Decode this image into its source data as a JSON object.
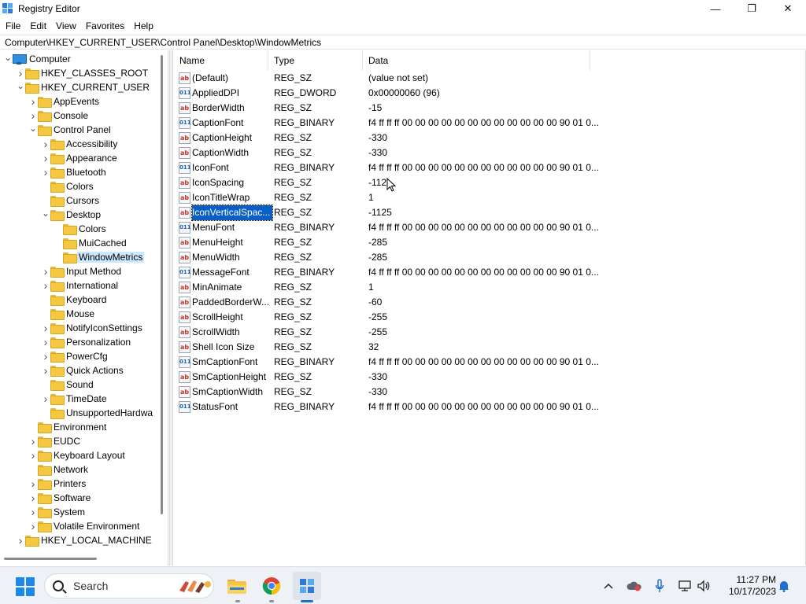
{
  "window": {
    "title": "Registry Editor",
    "controls": {
      "minimize": "—",
      "maximize": "❐",
      "close": "✕"
    }
  },
  "menu": [
    "File",
    "Edit",
    "View",
    "Favorites",
    "Help"
  ],
  "address": "Computer\\HKEY_CURRENT_USER\\Control Panel\\Desktop\\WindowMetrics",
  "tree": [
    {
      "label": "Computer",
      "depth": 0,
      "state": "expanded",
      "icon": "computer-icon"
    },
    {
      "label": "HKEY_CLASSES_ROOT",
      "depth": 1,
      "state": "collapsed",
      "icon": "folder-icon"
    },
    {
      "label": "HKEY_CURRENT_USER",
      "depth": 1,
      "state": "expanded",
      "icon": "folder-icon"
    },
    {
      "label": "AppEvents",
      "depth": 2,
      "state": "collapsed",
      "icon": "folder-icon"
    },
    {
      "label": "Console",
      "depth": 2,
      "state": "collapsed",
      "icon": "folder-icon"
    },
    {
      "label": "Control Panel",
      "depth": 2,
      "state": "expanded",
      "icon": "folder-icon"
    },
    {
      "label": "Accessibility",
      "depth": 3,
      "state": "collapsed",
      "icon": "folder-icon"
    },
    {
      "label": "Appearance",
      "depth": 3,
      "state": "collapsed",
      "icon": "folder-icon"
    },
    {
      "label": "Bluetooth",
      "depth": 3,
      "state": "collapsed",
      "icon": "folder-icon"
    },
    {
      "label": "Colors",
      "depth": 3,
      "state": "leaf",
      "icon": "folder-icon"
    },
    {
      "label": "Cursors",
      "depth": 3,
      "state": "leaf",
      "icon": "folder-icon"
    },
    {
      "label": "Desktop",
      "depth": 3,
      "state": "expanded",
      "icon": "folder-icon"
    },
    {
      "label": "Colors",
      "depth": 4,
      "state": "leaf",
      "icon": "folder-icon"
    },
    {
      "label": "MuiCached",
      "depth": 4,
      "state": "leaf",
      "icon": "folder-icon"
    },
    {
      "label": "WindowMetrics",
      "depth": 4,
      "state": "leaf",
      "icon": "folder-icon",
      "selected": true
    },
    {
      "label": "Input Method",
      "depth": 3,
      "state": "collapsed",
      "icon": "folder-icon"
    },
    {
      "label": "International",
      "depth": 3,
      "state": "collapsed",
      "icon": "folder-icon"
    },
    {
      "label": "Keyboard",
      "depth": 3,
      "state": "leaf",
      "icon": "folder-icon"
    },
    {
      "label": "Mouse",
      "depth": 3,
      "state": "leaf",
      "icon": "folder-icon"
    },
    {
      "label": "NotifyIconSettings",
      "depth": 3,
      "state": "collapsed",
      "icon": "folder-icon"
    },
    {
      "label": "Personalization",
      "depth": 3,
      "state": "collapsed",
      "icon": "folder-icon"
    },
    {
      "label": "PowerCfg",
      "depth": 3,
      "state": "collapsed",
      "icon": "folder-icon"
    },
    {
      "label": "Quick Actions",
      "depth": 3,
      "state": "collapsed",
      "icon": "folder-icon"
    },
    {
      "label": "Sound",
      "depth": 3,
      "state": "leaf",
      "icon": "folder-icon"
    },
    {
      "label": "TimeDate",
      "depth": 3,
      "state": "collapsed",
      "icon": "folder-icon"
    },
    {
      "label": "UnsupportedHardwa",
      "depth": 3,
      "state": "leaf",
      "icon": "folder-icon"
    },
    {
      "label": "Environment",
      "depth": 2,
      "state": "leaf",
      "icon": "folder-icon"
    },
    {
      "label": "EUDC",
      "depth": 2,
      "state": "collapsed",
      "icon": "folder-icon"
    },
    {
      "label": "Keyboard Layout",
      "depth": 2,
      "state": "collapsed",
      "icon": "folder-icon"
    },
    {
      "label": "Network",
      "depth": 2,
      "state": "leaf",
      "icon": "folder-icon"
    },
    {
      "label": "Printers",
      "depth": 2,
      "state": "collapsed",
      "icon": "folder-icon"
    },
    {
      "label": "Software",
      "depth": 2,
      "state": "collapsed",
      "icon": "folder-icon"
    },
    {
      "label": "System",
      "depth": 2,
      "state": "collapsed",
      "icon": "folder-icon"
    },
    {
      "label": "Volatile Environment",
      "depth": 2,
      "state": "collapsed",
      "icon": "folder-icon"
    },
    {
      "label": "HKEY_LOCAL_MACHINE",
      "depth": 1,
      "state": "collapsed",
      "icon": "folder-icon"
    }
  ],
  "list": {
    "columns": [
      "Name",
      "Type",
      "Data"
    ],
    "rows": [
      {
        "name": "(Default)",
        "type": "REG_SZ",
        "data": "(value not set)",
        "icon": "string-value-icon"
      },
      {
        "name": "AppliedDPI",
        "type": "REG_DWORD",
        "data": "0x00000060 (96)",
        "icon": "binary-value-icon"
      },
      {
        "name": "BorderWidth",
        "type": "REG_SZ",
        "data": "-15",
        "icon": "string-value-icon"
      },
      {
        "name": "CaptionFont",
        "type": "REG_BINARY",
        "data": "f4 ff ff ff 00 00 00 00 00 00 00 00 00 00 00 00 90 01 0...",
        "icon": "binary-value-icon"
      },
      {
        "name": "CaptionHeight",
        "type": "REG_SZ",
        "data": "-330",
        "icon": "string-value-icon"
      },
      {
        "name": "CaptionWidth",
        "type": "REG_SZ",
        "data": "-330",
        "icon": "string-value-icon"
      },
      {
        "name": "IconFont",
        "type": "REG_BINARY",
        "data": "f4 ff ff ff 00 00 00 00 00 00 00 00 00 00 00 00 90 01 0...",
        "icon": "binary-value-icon"
      },
      {
        "name": "IconSpacing",
        "type": "REG_SZ",
        "data": "-112",
        "icon": "string-value-icon"
      },
      {
        "name": "IconTitleWrap",
        "type": "REG_SZ",
        "data": "1",
        "icon": "string-value-icon"
      },
      {
        "name": "IconVerticalSpac...",
        "type": "REG_SZ",
        "data": "-1125",
        "icon": "string-value-icon",
        "selected": true
      },
      {
        "name": "MenuFont",
        "type": "REG_BINARY",
        "data": "f4 ff ff ff 00 00 00 00 00 00 00 00 00 00 00 00 90 01 0...",
        "icon": "binary-value-icon"
      },
      {
        "name": "MenuHeight",
        "type": "REG_SZ",
        "data": "-285",
        "icon": "string-value-icon"
      },
      {
        "name": "MenuWidth",
        "type": "REG_SZ",
        "data": "-285",
        "icon": "string-value-icon"
      },
      {
        "name": "MessageFont",
        "type": "REG_BINARY",
        "data": "f4 ff ff ff 00 00 00 00 00 00 00 00 00 00 00 00 90 01 0...",
        "icon": "binary-value-icon"
      },
      {
        "name": "MinAnimate",
        "type": "REG_SZ",
        "data": "1",
        "icon": "string-value-icon"
      },
      {
        "name": "PaddedBorderW...",
        "type": "REG_SZ",
        "data": "-60",
        "icon": "string-value-icon"
      },
      {
        "name": "ScrollHeight",
        "type": "REG_SZ",
        "data": "-255",
        "icon": "string-value-icon"
      },
      {
        "name": "ScrollWidth",
        "type": "REG_SZ",
        "data": "-255",
        "icon": "string-value-icon"
      },
      {
        "name": "Shell Icon Size",
        "type": "REG_SZ",
        "data": "32",
        "icon": "string-value-icon"
      },
      {
        "name": "SmCaptionFont",
        "type": "REG_BINARY",
        "data": "f4 ff ff ff 00 00 00 00 00 00 00 00 00 00 00 00 90 01 0...",
        "icon": "binary-value-icon"
      },
      {
        "name": "SmCaptionHeight",
        "type": "REG_SZ",
        "data": "-330",
        "icon": "string-value-icon"
      },
      {
        "name": "SmCaptionWidth",
        "type": "REG_SZ",
        "data": "-330",
        "icon": "string-value-icon"
      },
      {
        "name": "StatusFont",
        "type": "REG_BINARY",
        "data": "f4 ff ff ff 00 00 00 00 00 00 00 00 00 00 00 00 90 01 0...",
        "icon": "binary-value-icon"
      }
    ]
  },
  "icon_labels": {
    "string": "ab",
    "binary": "011"
  },
  "taskbar": {
    "search_label": "Search",
    "apps": [
      "file-explorer-icon",
      "chrome-icon",
      "registry-editor-icon"
    ],
    "tray": [
      "chevron-up-icon",
      "onedrive-icon",
      "microphone-icon",
      "network-icon",
      "volume-icon"
    ],
    "time": "11:27 PM",
    "date": "10/17/2023"
  },
  "colors": {
    "selection": "#0a5fc4",
    "tree_selection": "#cce8ff",
    "folder": "#f5c842",
    "accent": "#1e88e5"
  }
}
